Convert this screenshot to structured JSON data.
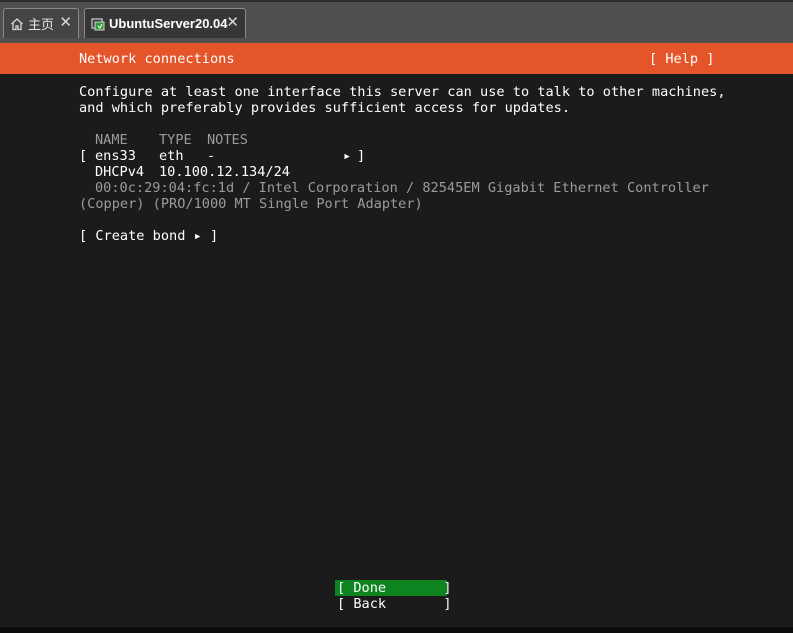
{
  "tabs": {
    "home": {
      "label": "主页",
      "icon": "home-icon",
      "close": "✕"
    },
    "vm": {
      "label": "UbuntuServer20.04",
      "icon": "vm-icon",
      "close": "✕"
    }
  },
  "header": {
    "title": "Network connections",
    "help": "[ Help ]",
    "color": "#e4552a"
  },
  "intro": {
    "line1": "Configure at least one interface this server can use to talk to other machines,",
    "line2": "and which preferably provides sufficient access for updates."
  },
  "table": {
    "col_name": "NAME",
    "col_type": "TYPE",
    "col_notes": "NOTES",
    "interface": {
      "bracket_open": "[",
      "name": "ens33",
      "type": "eth",
      "notes": "-",
      "arrow": "▸",
      "bracket_close": "]",
      "dhcp_label": "DHCPv4",
      "address": "10.100.12.134/24",
      "hw_line1": "00:0c:29:04:fc:1d / Intel Corporation / 82545EM Gigabit Ethernet Controller",
      "hw_line2": "(Copper) (PRO/1000 MT Single Port Adapter)"
    }
  },
  "create_bond": "[ Create bond ▸ ]",
  "buttons": {
    "done": "[ Done       ]",
    "back": "[ Back       ]",
    "done_color": "#0e8420"
  }
}
